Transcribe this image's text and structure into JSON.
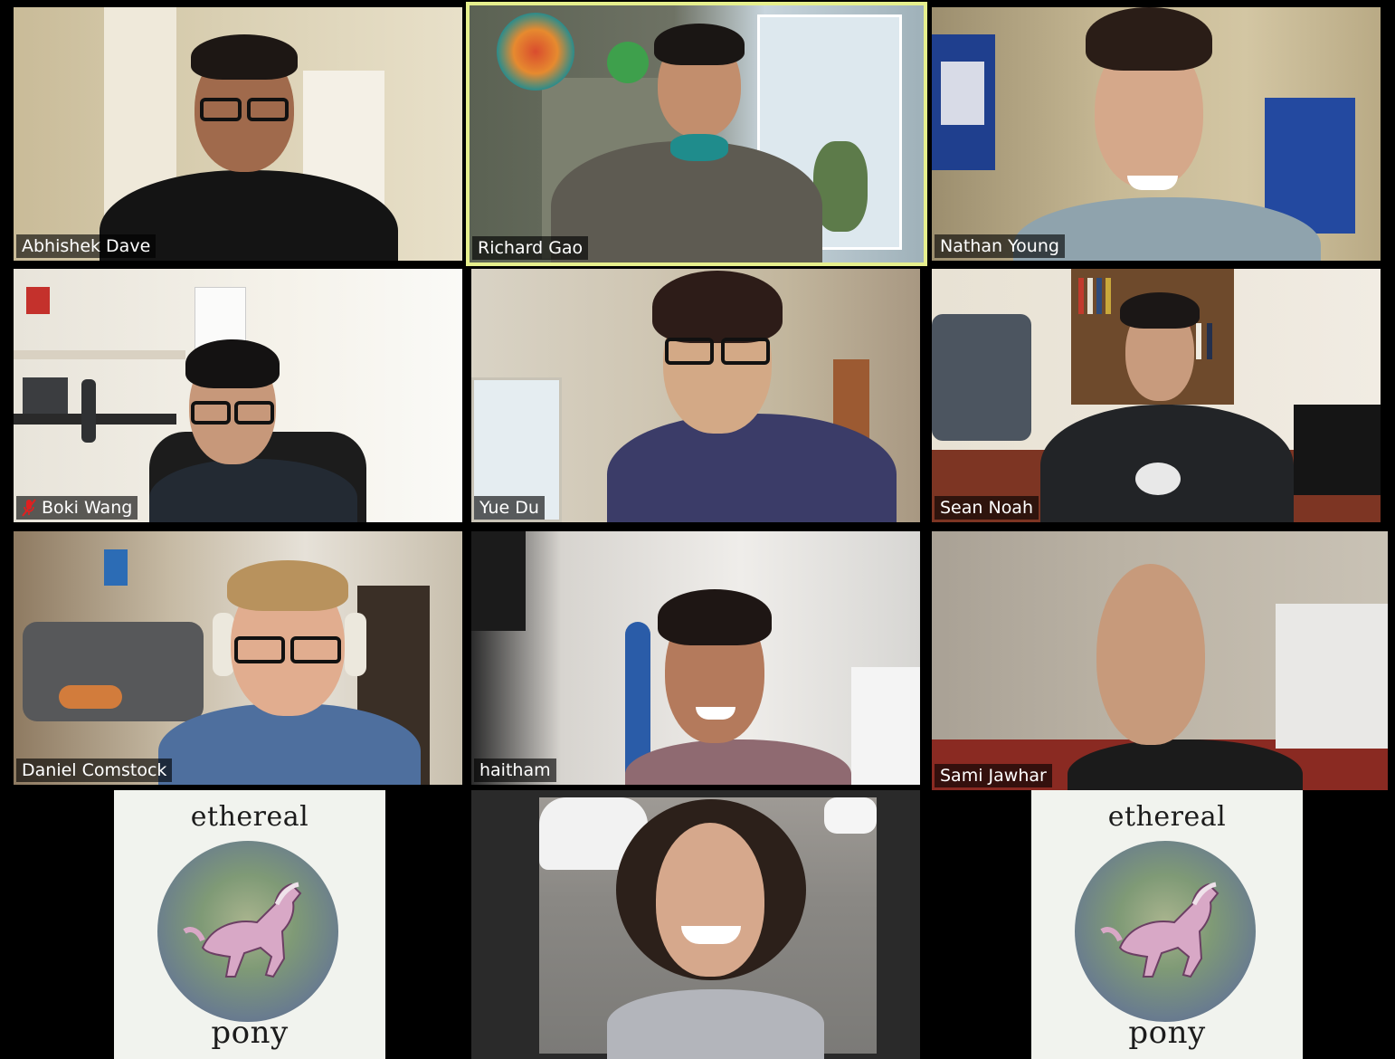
{
  "meeting": {
    "participants": [
      {
        "name": "Abhishek Dave",
        "muted": false,
        "active": false
      },
      {
        "name": "Richard Gao",
        "muted": false,
        "active": true
      },
      {
        "name": "Nathan Young",
        "muted": false,
        "active": false
      },
      {
        "name": "Boki Wang",
        "muted": true,
        "active": false
      },
      {
        "name": "Yue Du",
        "muted": false,
        "active": false
      },
      {
        "name": "Sean Noah",
        "muted": false,
        "active": false
      },
      {
        "name": "Daniel Comstock",
        "muted": false,
        "active": false
      },
      {
        "name": "haitham",
        "muted": false,
        "active": false
      },
      {
        "name": "Sami Jawhar",
        "muted": false,
        "active": false
      }
    ],
    "logo_cards": [
      {
        "top_word": "ethereal",
        "bottom_word": "pony"
      },
      {
        "top_word": "ethereal",
        "bottom_word": "pony"
      }
    ]
  },
  "colors": {
    "active_speaker_border": "#e6ef8d",
    "background": "#000000",
    "name_tag_bg": "rgba(0,0,0,0.62)",
    "mute_icon": "#e02020"
  },
  "icons": {
    "mute": "microphone-muted-icon"
  }
}
